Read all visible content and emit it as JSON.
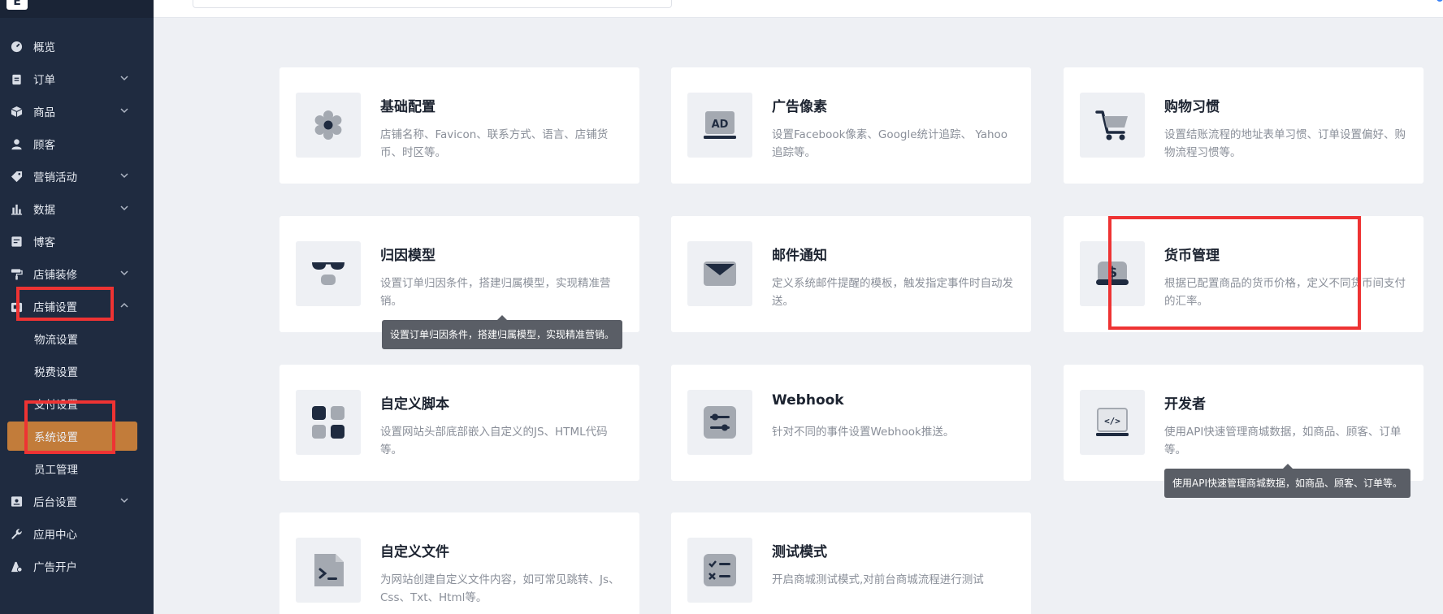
{
  "logo": {
    "letter": "E"
  },
  "sidebar": {
    "items": [
      {
        "label": "概览",
        "icon": "dashboard-icon",
        "chevron": false
      },
      {
        "label": "订单",
        "icon": "clipboard-icon",
        "chevron": true
      },
      {
        "label": "商品",
        "icon": "box-icon",
        "chevron": true
      },
      {
        "label": "顾客",
        "icon": "user-icon",
        "chevron": false
      },
      {
        "label": "营销活动",
        "icon": "tag-icon",
        "chevron": true
      },
      {
        "label": "数据",
        "icon": "bar-chart-icon",
        "chevron": true
      },
      {
        "label": "博客",
        "icon": "blog-icon",
        "chevron": false
      },
      {
        "label": "店铺装修",
        "icon": "paint-roller-icon",
        "chevron": true
      },
      {
        "label": "店铺设置",
        "icon": "store-icon",
        "chevron": true,
        "expanded": true
      }
    ],
    "sub_items": [
      {
        "label": "物流设置"
      },
      {
        "label": "税费设置"
      },
      {
        "label": "支付设置"
      },
      {
        "label": "系统设置",
        "active": true
      },
      {
        "label": "员工管理"
      }
    ],
    "items_after": [
      {
        "label": "后台设置",
        "icon": "admin-icon",
        "chevron": true
      },
      {
        "label": "应用中心",
        "icon": "wrench-icon",
        "chevron": false
      },
      {
        "label": "广告开户",
        "icon": "ad-open-icon",
        "chevron": false
      }
    ]
  },
  "cards": [
    {
      "title": "基础配置",
      "desc": "店铺名称、Favicon、联系方式、语言、店铺货币、时区等。",
      "icon": "gear-icon"
    },
    {
      "title": "广告像素",
      "desc": "设置Facebook像素、Google统计追踪、 Yahoo追踪等。",
      "icon": "ad-monitor-icon"
    },
    {
      "title": "购物习惯",
      "desc": "设置结账流程的地址表单习惯、订单设置偏好、购物流程习惯等。",
      "icon": "cart-icon"
    },
    {
      "title": "归因模型",
      "desc": "设置订单归因条件，搭建归属模型，实现精准营销。",
      "icon": "glasses-icon"
    },
    {
      "title": "邮件通知",
      "desc": "定义系统邮件提醒的模板，触发指定事件时自动发送。",
      "icon": "envelope-icon"
    },
    {
      "title": "货币管理",
      "desc": "根据已配置商品的货币价格，定义不同货币间支付的汇率。",
      "icon": "currency-icon"
    },
    {
      "title": "自定义脚本",
      "desc": "设置网站头部底部嵌入自定义的JS、HTML代码等。",
      "icon": "blocks-icon"
    },
    {
      "title": "Webhook",
      "desc": "针对不同的事件设置Webhook推送。",
      "icon": "sliders-icon"
    },
    {
      "title": "开发者",
      "desc": "使用API快速管理商城数据，如商品、顾客、订单等。",
      "icon": "code-laptop-icon"
    },
    {
      "title": "自定义文件",
      "desc": "为网站创建自定义文件内容，如可常见跳转、Js、Css、Txt、Html等。",
      "icon": "terminal-file-icon"
    },
    {
      "title": "测试模式",
      "desc": "开启商城测试模式,对前台商城流程进行测试",
      "icon": "checklist-icon"
    }
  ],
  "tooltips": [
    {
      "text": "设置订单归因条件，搭建归属模型，实现精准营销。"
    },
    {
      "text": "使用API快速管理商城数据，如商品、顾客、订单等。"
    }
  ],
  "colors": {
    "sidebar_bg": "#1f2b40",
    "active_item": "#c27c3a",
    "page_bg": "#eef0f4",
    "highlight_box": "#ee3333"
  }
}
